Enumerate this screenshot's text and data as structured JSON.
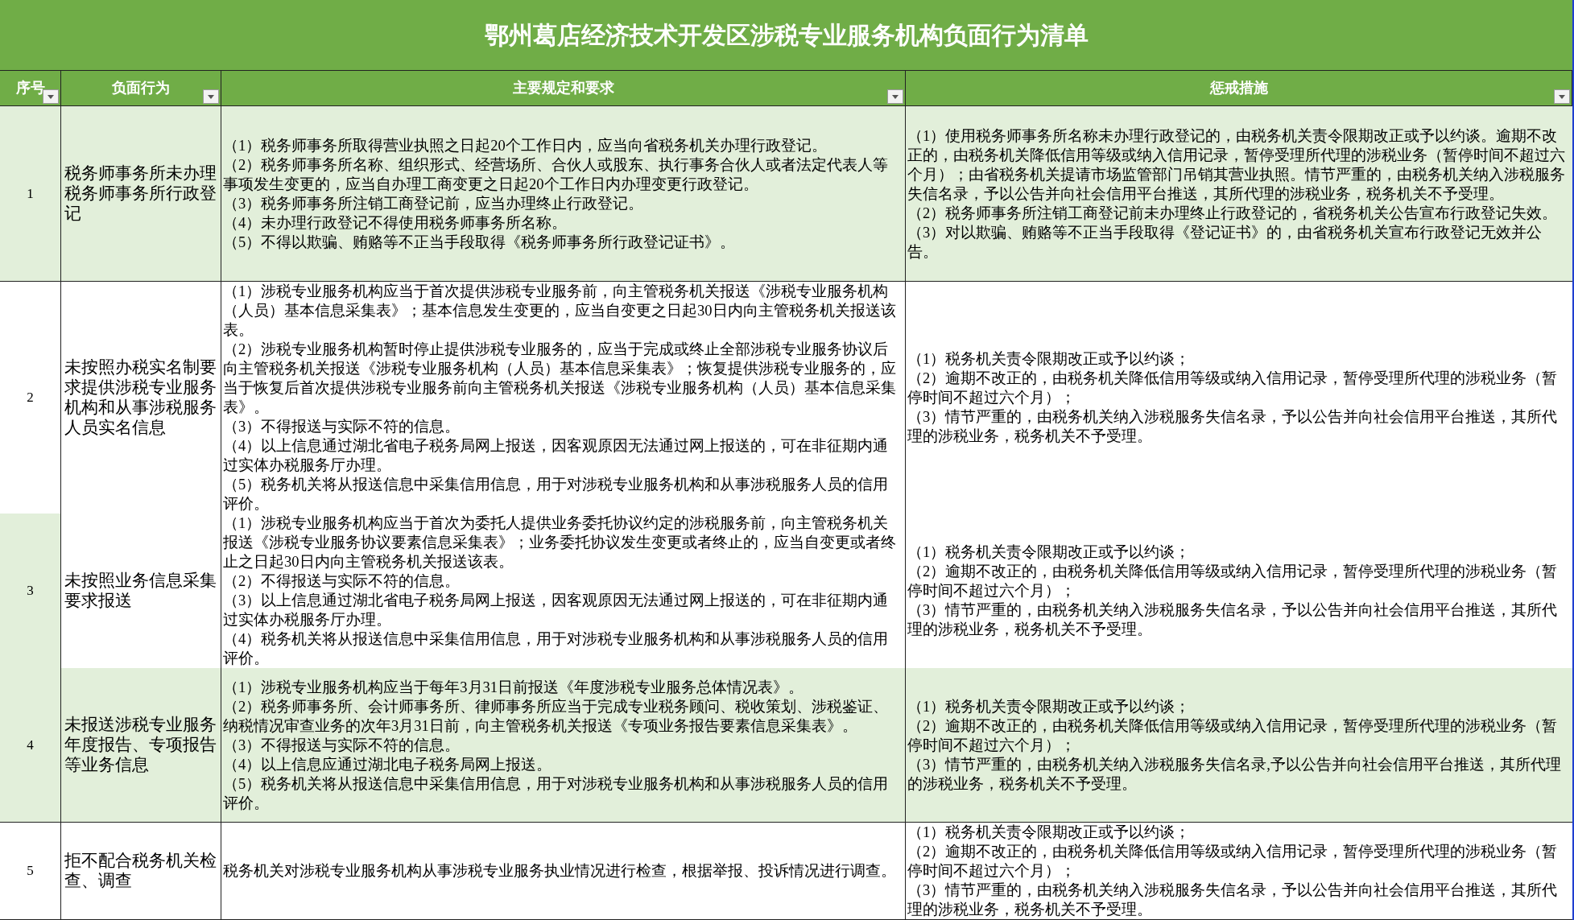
{
  "title": "鄂州葛店经济技术开发区涉税专业服务机构负面行为清单",
  "columns": [
    {
      "label": "序号"
    },
    {
      "label": "负面行为"
    },
    {
      "label": "主要规定和要求"
    },
    {
      "label": "惩戒措施"
    }
  ],
  "rows": [
    {
      "number": "1",
      "shaded": true,
      "number_shaded": true,
      "behavior": "税务师事务所未办理税务师事务所行政登记",
      "requirements": [
        "（1）税务师事务所取得营业执照之日起20个工作日内，应当向省税务机关办理行政登记。",
        "（2）税务师事务所名称、组织形式、经营场所、合伙人或股东、执行事务合伙人或者法定代表人等事项发生变更的，应当自办理工商变更之日起20个工作日内办理变更行政登记。",
        "（3）税务师事务所注销工商登记前，应当办理终止行政登记。",
        "（4）未办理行政登记不得使用税务师事务所名称。",
        "（5）不得以欺骗、贿赂等不正当手段取得《税务师事务所行政登记证书》。"
      ],
      "measures": [
        "（1）使用税务师事务所名称未办理行政登记的，由税务机关责令限期改正或予以约谈。逾期不改正的，由税务机关降低信用等级或纳入信用记录，暂停受理所代理的涉税业务（暂停时间不超过六个月）；由省税务机关提请市场监管部门吊销其营业执照。情节严重的，由税务机关纳入涉税服务失信名录，予以公告并向社会信用平台推送，其所代理的涉税业务，税务机关不予受理。",
        "（2）税务师事务所注销工商登记前未办理终止行政登记的，省税务机关公告宣布行政登记失效。",
        "（3）对以欺骗、贿赂等不正当手段取得《登记证书》的，由省税务机关宣布行政登记无效并公告。"
      ]
    },
    {
      "number": "2",
      "shaded": false,
      "number_shaded": false,
      "behavior": "未按照办税实名制要求提供涉税专业服务机构和从事涉税服务人员实名信息",
      "requirements": [
        "（1）涉税专业服务机构应当于首次提供涉税专业服务前，向主管税务机关报送《涉税专业服务机构（人员）基本信息采集表》；基本信息发生变更的，应当自变更之日起30日内向主管税务机关报送该表。",
        "（2）涉税专业服务机构暂时停止提供涉税专业服务的，应当于完成或终止全部涉税专业服务协议后向主管税务机关报送《涉税专业服务机构（人员）基本信息采集表》；恢复提供涉税专业服务的，应当于恢复后首次提供涉税专业服务前向主管税务机关报送《涉税专业服务机构（人员）基本信息采集表》。",
        "（3）不得报送与实际不符的信息。",
        "（4）以上信息通过湖北省电子税务局网上报送，因客观原因无法通过网上报送的，可在非征期内通过实体办税服务厅办理。",
        "（5）税务机关将从报送信息中采集信用信息，用于对涉税专业服务机构和从事涉税服务人员的信用评价。"
      ],
      "measures": [
        "（1）税务机关责令限期改正或予以约谈；",
        "（2）逾期不改正的，由税务机关降低信用等级或纳入信用记录，暂停受理所代理的涉税业务（暂停时间不超过六个月）；",
        "（3）情节严重的，由税务机关纳入涉税服务失信名录，予以公告并向社会信用平台推送，其所代理的涉税业务，税务机关不予受理。"
      ]
    },
    {
      "number": "3",
      "shaded": false,
      "number_shaded": true,
      "behavior": "未按照业务信息采集要求报送",
      "requirements": [
        "（1）涉税专业服务机构应当于首次为委托人提供业务委托协议约定的涉税服务前，向主管税务机关报送《涉税专业服务协议要素信息采集表》；业务委托协议发生变更或者终止的，应当自变更或者终止之日起30日内向主管税务机关报送该表。",
        "（2）不得报送与实际不符的信息。",
        "（3）以上信息通过湖北省电子税务局网上报送，因客观原因无法通过网上报送的，可在非征期内通过实体办税服务厅办理。",
        "（4）税务机关将从报送信息中采集信用信息，用于对涉税专业服务机构和从事涉税服务人员的信用评价。"
      ],
      "measures": [
        "（1）税务机关责令限期改正或予以约谈；",
        "（2）逾期不改正的，由税务机关降低信用等级或纳入信用记录，暂停受理所代理的涉税业务（暂停时间不超过六个月）；",
        "（3）情节严重的，由税务机关纳入涉税服务失信名录，予以公告并向社会信用平台推送，其所代理的涉税业务，税务机关不予受理。"
      ]
    },
    {
      "number": "4",
      "shaded": true,
      "number_shaded": true,
      "behavior": "未报送涉税专业服务年度报告、专项报告等业务信息",
      "requirements": [
        "（1）涉税专业服务机构应当于每年3月31日前报送《年度涉税专业服务总体情况表》。",
        "（2）税务师事务所、会计师事务所、律师事务所应当于完成专业税务顾问、税收策划、涉税鉴证、纳税情况审查业务的次年3月31日前，向主管税务机关报送《专项业务报告要素信息采集表》。",
        "（3）不得报送与实际不符的信息。",
        "（4）以上信息应通过湖北电子税务局网上报送。",
        "（5）税务机关将从报送信息中采集信用信息，用于对涉税专业服务机构和从事涉税服务人员的信用评价。"
      ],
      "measures": [
        "（1）税务机关责令限期改正或予以约谈；",
        "（2）逾期不改正的，由税务机关降低信用等级或纳入信用记录，暂停受理所代理的涉税业务（暂停时间不超过六个月）；",
        "（3）情节严重的，由税务机关纳入涉税服务失信名录,予以公告并向社会信用平台推送，其所代理的涉税业务，税务机关不予受理。"
      ]
    },
    {
      "number": "5",
      "shaded": false,
      "number_shaded": false,
      "behavior": "拒不配合税务机关检查、调查",
      "requirements": [
        "税务机关对涉税专业服务机构从事涉税专业服务执业情况进行检查，根据举报、投诉情况进行调查。"
      ],
      "measures": [
        "（1）税务机关责令限期改正或予以约谈；",
        "（2）逾期不改正的，由税务机关降低信用等级或纳入信用记录，暂停受理所代理的涉税业务（暂停时间不超过六个月）；",
        "（3）情节严重的，由税务机关纳入涉税服务失信名录，予以公告并向社会信用平台推送，其所代理的涉税业务，税务机关不予受理。"
      ]
    }
  ]
}
